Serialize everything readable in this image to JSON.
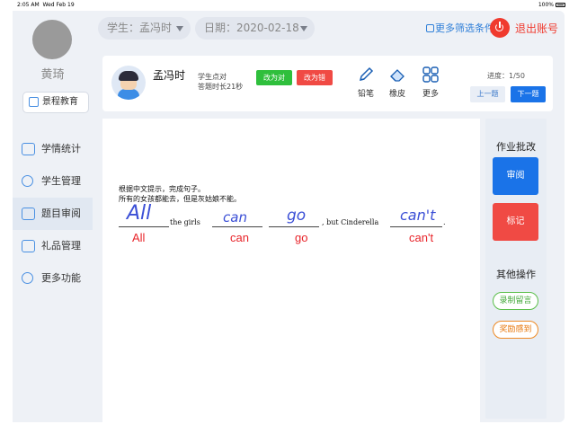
{
  "status_bar": {
    "time": "2:05 AM",
    "date": "Wed Feb 19",
    "battery": "100%"
  },
  "sidebar": {
    "user_name": "黄琦",
    "school": "景程教育",
    "items": [
      {
        "label": "学情统计",
        "icon": "stats-icon",
        "active": false
      },
      {
        "label": "学生管理",
        "icon": "student-icon",
        "active": false
      },
      {
        "label": "题目审阅",
        "icon": "review-icon",
        "active": true
      },
      {
        "label": "礼品管理",
        "icon": "gift-icon",
        "active": false
      },
      {
        "label": "更多功能",
        "icon": "more-user-icon",
        "active": false
      }
    ]
  },
  "filters": {
    "student": "学生：孟冯时",
    "date": "日期：2020-02-18",
    "more": "更多筛选条件",
    "logout": "退出账号"
  },
  "student_card": {
    "name": "孟冯时",
    "accuracy": "学生点对",
    "time_spent": "答题时长21秒",
    "mark_correct": "改为对",
    "mark_wrong": "改为错",
    "tools": {
      "pencil": "铅笔",
      "eraser": "橡皮",
      "more": "更多"
    },
    "progress": "进度：1/50",
    "prev": "上一题",
    "next": "下一题"
  },
  "question": {
    "instruction": "根据中文提示，完成句子。",
    "chinese": "所有的女孩都能去，但是灰姑娘不能。",
    "sentence_parts": [
      "the girls",
      ", but Cinderella",
      "."
    ],
    "handwritten": [
      "All",
      "can",
      "go",
      "can't"
    ],
    "answers": [
      "All",
      "can",
      "go",
      "can't"
    ]
  },
  "right_panel": {
    "title": "作业批改",
    "audit": "审阅",
    "mark": "标记",
    "other_title": "其他操作",
    "voice_note": "录制留言",
    "reward": "奖励感到"
  },
  "colors": {
    "primary": "#1a73e8",
    "danger": "#f04a44",
    "success": "#2fbf3c",
    "handwriting": "#3b4fd6",
    "answer": "#e8242a"
  }
}
